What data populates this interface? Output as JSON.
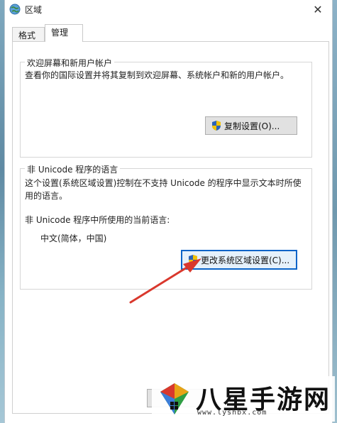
{
  "window": {
    "title": "区域",
    "close_glyph": "✕"
  },
  "tabs": [
    {
      "label": "格式",
      "active": false
    },
    {
      "label": "管理",
      "active": true
    }
  ],
  "welcome_group": {
    "legend": "欢迎屏幕和新用户帐户",
    "description": "查看你的国际设置并将其复制到欢迎屏幕、系统帐户和新的用户帐户。",
    "copy_button": "复制设置(O)..."
  },
  "unicode_group": {
    "legend": "非 Unicode 程序的语言",
    "description_line1": "这个设置(系统区域设置)控制在不支持 Unicode 的程序中显示文本时所使",
    "description_line2": "用的语言。",
    "current_label": "非 Unicode 程序中所使用的当前语言:",
    "current_value": "中文(简体，中国)",
    "change_button": "更改系统区域设置(C)..."
  },
  "watermark": {
    "brand": "八星手游网",
    "url": "www.lyshbx.com"
  },
  "colors": {
    "arrow": "#d9382d",
    "focus_border": "#0a64c8"
  }
}
